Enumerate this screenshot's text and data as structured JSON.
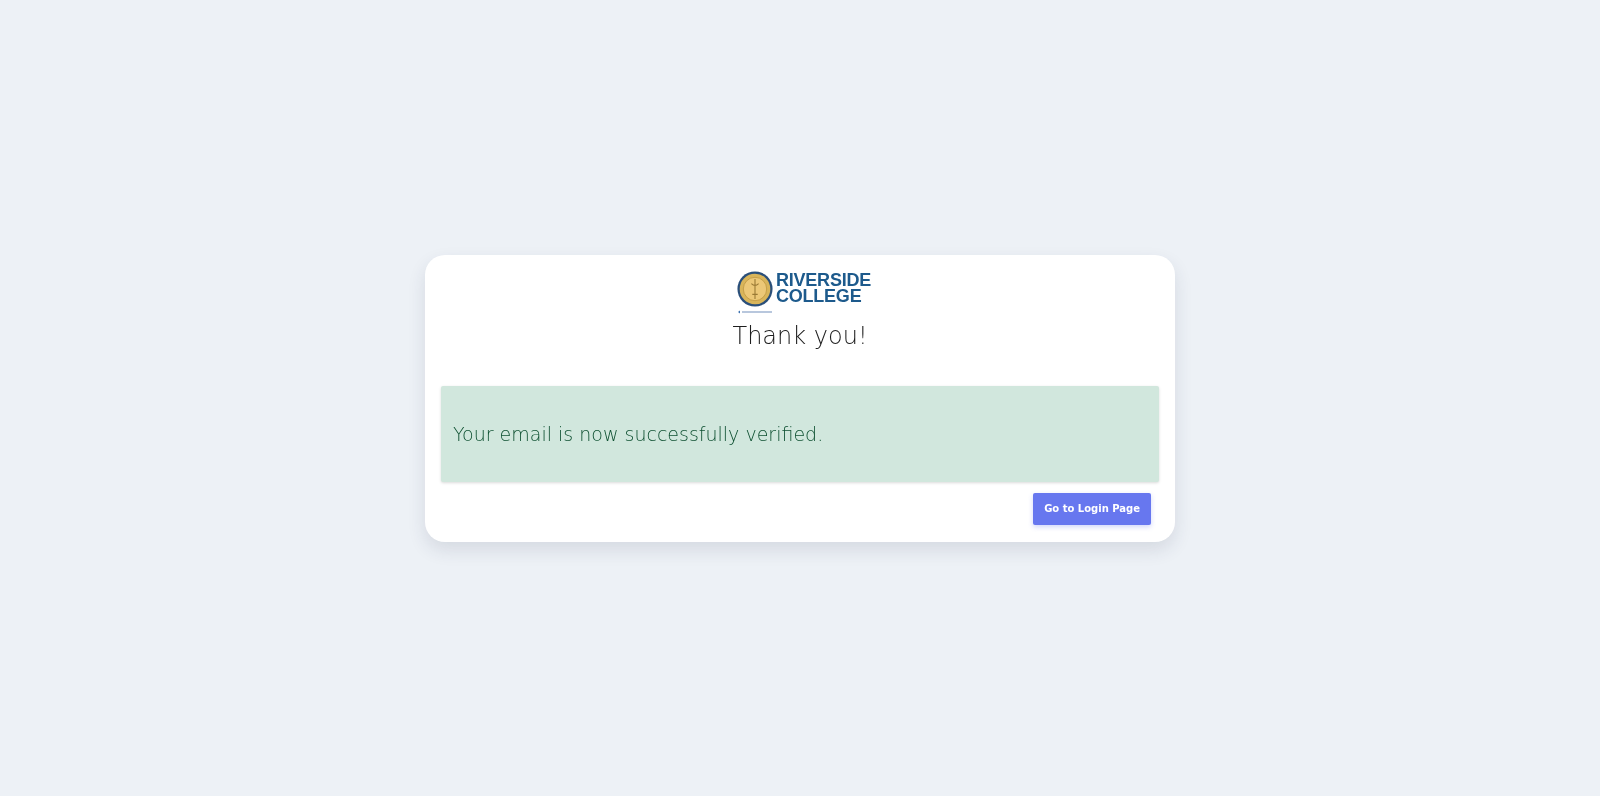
{
  "logo": {
    "name_lines": [
      "RIVERSIDE",
      "COLLEGE"
    ]
  },
  "title": "Thank you!",
  "alert": {
    "kind": "success",
    "message": "Your email is now successfully verified."
  },
  "actions": [
    {
      "label": "Go to Login Page",
      "kind": "primary"
    }
  ]
}
